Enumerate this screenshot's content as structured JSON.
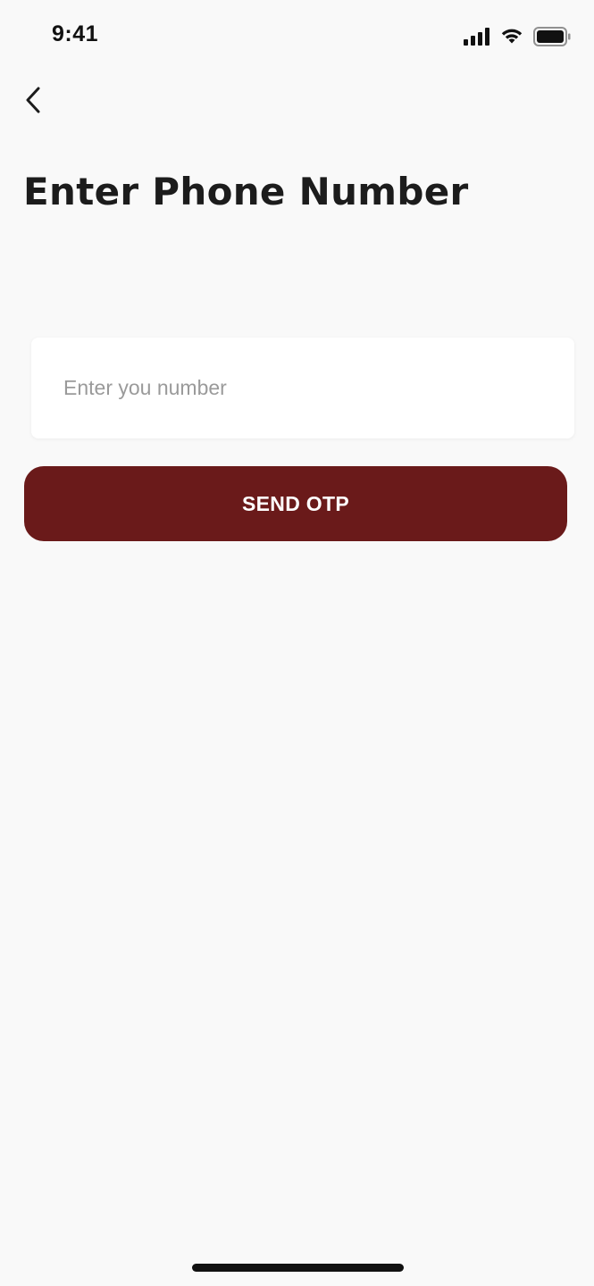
{
  "status_bar": {
    "time": "9:41",
    "icons": [
      "cellular-signal-icon",
      "wifi-icon",
      "battery-icon"
    ]
  },
  "header": {
    "back_icon": "chevron-left-icon",
    "title": "Enter Phone Number"
  },
  "form": {
    "phone_input": {
      "value": "",
      "placeholder": "Enter you number"
    },
    "send_otp_label": "SEND OTP"
  },
  "colors": {
    "background": "#f9f9f9",
    "primary_button": "#6a1a1a",
    "button_text": "#ffffff",
    "title_text": "#1c1c1c",
    "placeholder_text": "#9a9a9a"
  }
}
